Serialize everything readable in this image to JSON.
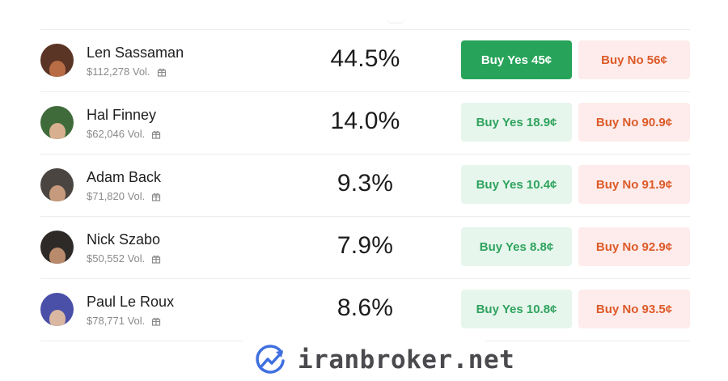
{
  "markets": [
    {
      "name": "Len Sassaman",
      "volume": "$112,278 Vol.",
      "probability": "44.5%",
      "buy_yes": "Buy Yes 45¢",
      "buy_no": "Buy No 56¢",
      "yes_active": true,
      "avatar_bg": "#5a3424",
      "face_color": "#b86d44"
    },
    {
      "name": "Hal Finney",
      "volume": "$62,046 Vol.",
      "probability": "14.0%",
      "buy_yes": "Buy Yes 18.9¢",
      "buy_no": "Buy No 90.9¢",
      "yes_active": false,
      "avatar_bg": "#3f6b3a",
      "face_color": "#d8b090"
    },
    {
      "name": "Adam Back",
      "volume": "$71,820 Vol.",
      "probability": "9.3%",
      "buy_yes": "Buy Yes 10.4¢",
      "buy_no": "Buy No 91.9¢",
      "yes_active": false,
      "avatar_bg": "#4a4540",
      "face_color": "#c69a7c"
    },
    {
      "name": "Nick Szabo",
      "volume": "$50,552 Vol.",
      "probability": "7.9%",
      "buy_yes": "Buy Yes 8.8¢",
      "buy_no": "Buy No 92.9¢",
      "yes_active": false,
      "avatar_bg": "#2e2a28",
      "face_color": "#b98b6c"
    },
    {
      "name": "Paul Le Roux",
      "volume": "$78,771 Vol.",
      "probability": "8.6%",
      "buy_yes": "Buy Yes 10.8¢",
      "buy_no": "Buy No 93.5¢",
      "yes_active": false,
      "avatar_bg": "#4a4fa8",
      "face_color": "#d9b7a0"
    }
  ],
  "watermark": {
    "text": "iranbroker.net",
    "icon": "chart-trend-logo-icon"
  },
  "colors": {
    "yes_active_bg": "#27a45a",
    "yes_bg": "#e6f6ec",
    "yes_text": "#2fa35e",
    "no_bg": "#fdeceb",
    "no_text": "#dd5a29",
    "logo_blue": "#3f6fe0"
  }
}
